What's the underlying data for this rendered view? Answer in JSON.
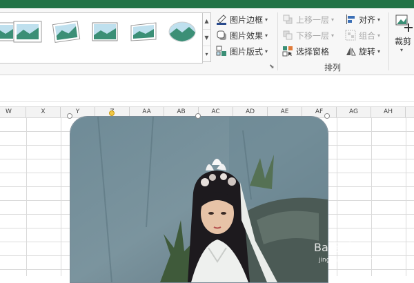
{
  "picture_styles": {
    "thumbnails": [
      "picture-style-1",
      "picture-style-2",
      "picture-style-3",
      "picture-style-4",
      "picture-style-5",
      "picture-style-6",
      "picture-style-7"
    ],
    "commands": [
      {
        "label": "图片边框",
        "icon": "picture-border-icon"
      },
      {
        "label": "图片效果",
        "icon": "picture-effects-icon"
      },
      {
        "label": "图片版式",
        "icon": "picture-layout-icon"
      }
    ]
  },
  "arrange": {
    "bring_forward": "上移一层",
    "send_backward": "下移一层",
    "selection_pane": "选择窗格",
    "align": "对齐",
    "group": "组合",
    "rotate": "旋转",
    "group_label": "排列"
  },
  "size": {
    "crop": "裁剪"
  },
  "columns": [
    "W",
    "X",
    "Y",
    "Z",
    "AA",
    "AB",
    "AC",
    "AD",
    "AE",
    "AF",
    "AG",
    "AH"
  ],
  "watermark": {
    "main": "Bai经验",
    "sub": "jingyan.baidu.com"
  },
  "colors": {
    "excel_green": "#217346",
    "selection_handle": "#f2c744"
  }
}
